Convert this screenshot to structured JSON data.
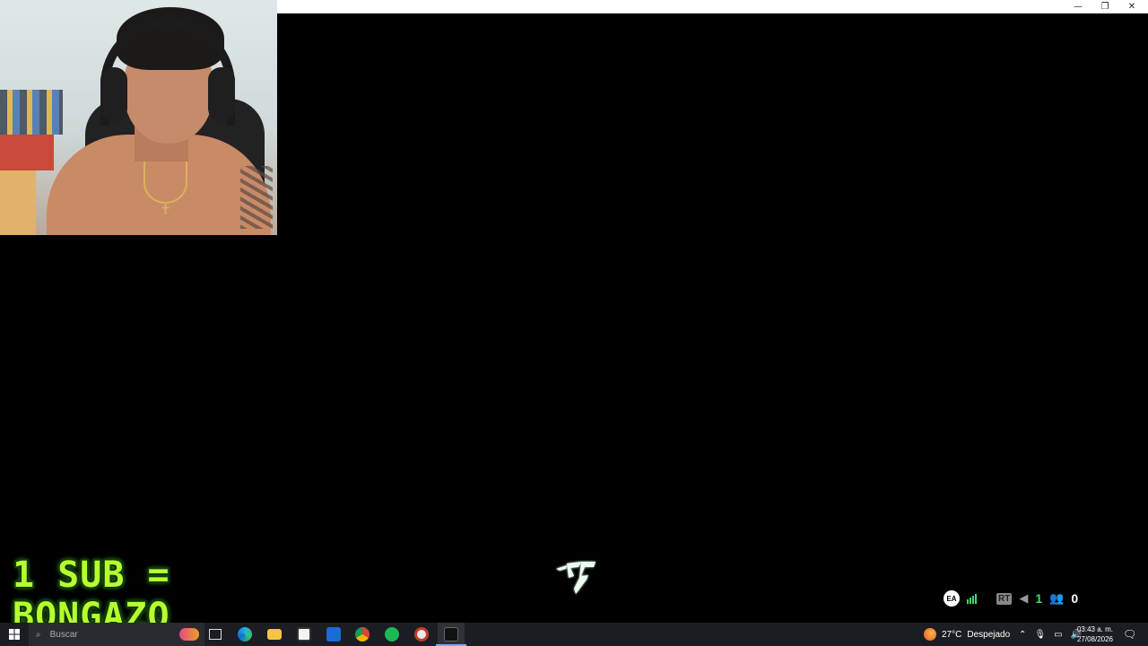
{
  "window": {
    "controls": {
      "minimize": "—",
      "restore": "❐",
      "close": "✕"
    }
  },
  "overlay": {
    "line1": "1 SUB =",
    "line2": "BONGAZO",
    "color": "#b8ff2e"
  },
  "game": {
    "logo_icon": "ea-sports-fc-icon",
    "hud": {
      "ea_label": "EA",
      "rt_label": "RT",
      "count_green": "1",
      "players": "0",
      "accent": "#3adf6a"
    }
  },
  "taskbar": {
    "search_placeholder": "Buscar",
    "apps": [
      "start-icon",
      "task-view-icon",
      "edge-icon",
      "file-explorer-icon",
      "store-icon",
      "mail-icon",
      "chrome-icon",
      "spotify-icon",
      "steam-icon",
      "ea-fc-icon"
    ],
    "weather": {
      "temp": "27°C",
      "condition": "Despejado"
    },
    "clock": {
      "time": "03:43 a. m.",
      "date": "27/08/2026"
    }
  }
}
